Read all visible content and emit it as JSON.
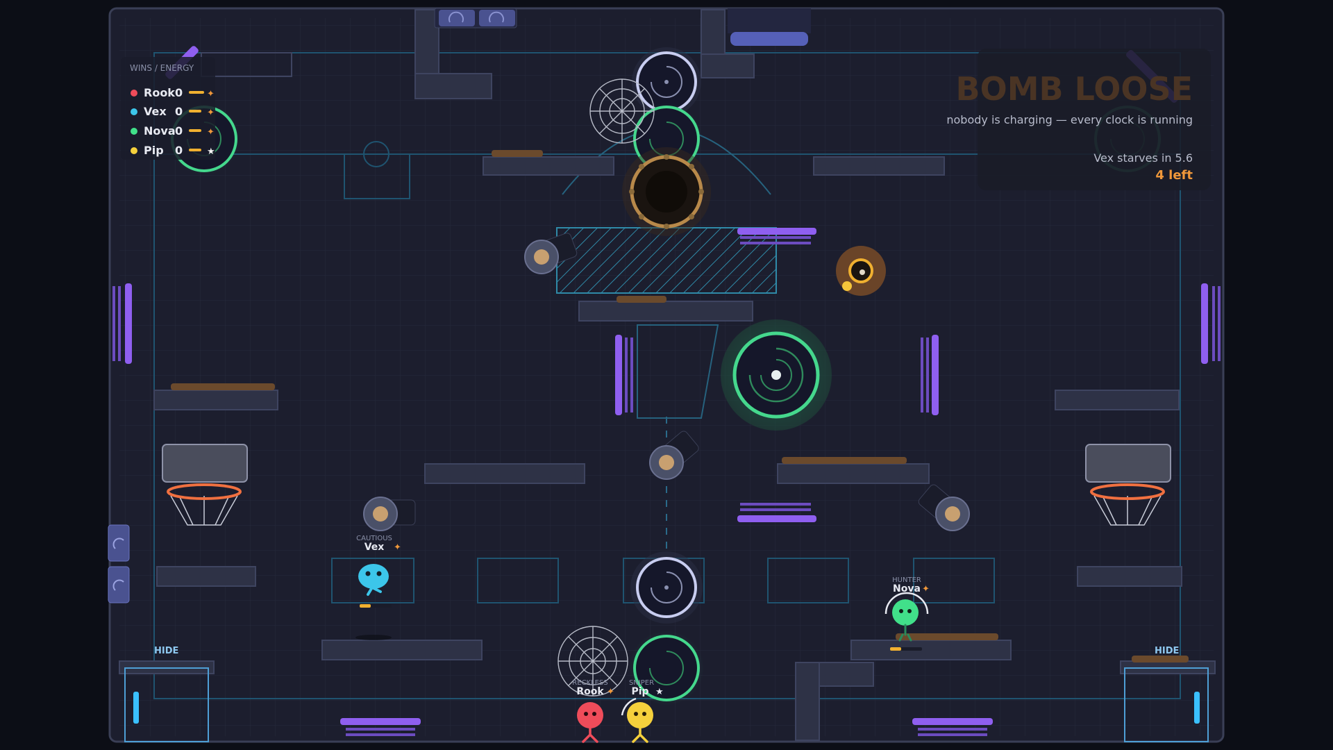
{
  "scoreboard": {
    "title": "WINS / ENERGY",
    "players": [
      {
        "name": "Rook",
        "wins": "0",
        "color": "#ef4c5a",
        "mark": "✦"
      },
      {
        "name": "Vex",
        "wins": "0",
        "color": "#3cc6ea",
        "mark": "✦"
      },
      {
        "name": "Nova",
        "wins": "0",
        "color": "#41e08a",
        "mark": "✦"
      },
      {
        "name": "Pip",
        "wins": "0",
        "color": "#f5d03c",
        "mark": "★"
      }
    ]
  },
  "status": {
    "headline": "BOMB LOOSE",
    "subline": "nobody is charging — every clock is running",
    "starve": "Vex starves in 5.6",
    "left": "4 left"
  },
  "zones": {
    "hide_left": "HIDE",
    "hide_right": "HIDE"
  },
  "characters": {
    "vex": {
      "role": "CAUTIOUS",
      "name": "Vex",
      "mark": "✦"
    },
    "nova": {
      "role": "HUNTER",
      "name": "Nova",
      "mark": "✦"
    },
    "rook": {
      "role": "RECKLESS",
      "name": "Rook",
      "mark": "✦"
    },
    "pip": {
      "role": "SNIPER",
      "name": "Pip",
      "mark": "★"
    }
  },
  "colors": {
    "bg": "#0c0e16",
    "arena": "#1c1e2e",
    "platform": "#2e3246",
    "accent_purple": "#8f5ff0",
    "accent_orange": "#f0983a",
    "portal_green": "#45d88d",
    "headline_brown": "#4a3424"
  }
}
